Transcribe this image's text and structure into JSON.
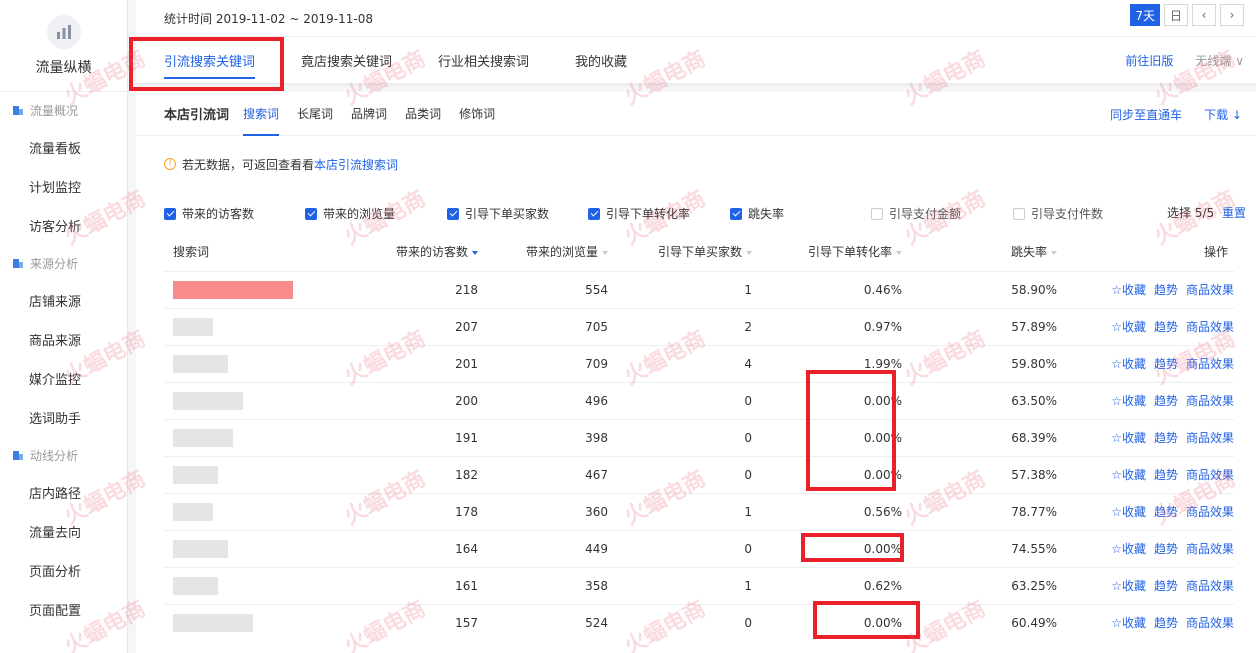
{
  "sidebar": {
    "logo_title": "流量纵横",
    "groups": [
      {
        "label": "流量概况",
        "items": [
          "流量看板",
          "计划监控",
          "访客分析"
        ]
      },
      {
        "label": "来源分析",
        "items": [
          "店铺来源",
          "商品来源",
          "媒介监控",
          "选词助手"
        ]
      },
      {
        "label": "动线分析",
        "items": [
          "店内路径",
          "流量去向",
          "页面分析",
          "页面配置"
        ]
      }
    ]
  },
  "topbar": {
    "date_range": "统计时间 2019-11-02 ~ 2019-11-08",
    "btn_7day": "7天",
    "btn_day": "日",
    "btn_prev": "‹",
    "btn_next": "›"
  },
  "main_tabs": [
    "引流搜索关键词",
    "竟店搜索关键词",
    "行业相关搜索词",
    "我的收藏"
  ],
  "tabs_right": {
    "old_version": "前往旧版",
    "device": "无线端 ∨"
  },
  "subbar": {
    "title": "本店引流词",
    "tabs": [
      "搜索词",
      "长尾词",
      "品牌词",
      "品类词",
      "修饰词"
    ],
    "sync": "同步至直通车",
    "download": "下载 ↓"
  },
  "notice": {
    "text": "若无数据，可返回查看看",
    "link": "本店引流搜索词"
  },
  "checks": [
    {
      "label": "带来的访客数",
      "on": true
    },
    {
      "label": "带来的浏览量",
      "on": true
    },
    {
      "label": "引导下单买家数",
      "on": true
    },
    {
      "label": "引导下单转化率",
      "on": true
    },
    {
      "label": "跳失率",
      "on": true
    },
    {
      "label": "引导支付金额",
      "on": false
    },
    {
      "label": "引导支付件数",
      "on": false
    }
  ],
  "checks_right": {
    "select": "选择 5/5",
    "reset": "重置"
  },
  "table": {
    "headers": [
      "搜索词",
      "带来的访客数",
      "带来的浏览量",
      "引导下单买家数",
      "引导下单转化率",
      "跳失率",
      "操作"
    ],
    "rows": [
      {
        "visitors": "218",
        "views": "554",
        "buyers": "1",
        "conv": "0.46%",
        "bounce": "58.90%"
      },
      {
        "visitors": "207",
        "views": "705",
        "buyers": "2",
        "conv": "0.97%",
        "bounce": "57.89%"
      },
      {
        "visitors": "201",
        "views": "709",
        "buyers": "4",
        "conv": "1.99%",
        "bounce": "59.80%"
      },
      {
        "visitors": "200",
        "views": "496",
        "buyers": "0",
        "conv": "0.00%",
        "bounce": "63.50%"
      },
      {
        "visitors": "191",
        "views": "398",
        "buyers": "0",
        "conv": "0.00%",
        "bounce": "68.39%"
      },
      {
        "visitors": "182",
        "views": "467",
        "buyers": "0",
        "conv": "0.00%",
        "bounce": "57.38%"
      },
      {
        "visitors": "178",
        "views": "360",
        "buyers": "1",
        "conv": "0.56%",
        "bounce": "78.77%"
      },
      {
        "visitors": "164",
        "views": "449",
        "buyers": "0",
        "conv": "0.00%",
        "bounce": "74.55%"
      },
      {
        "visitors": "161",
        "views": "358",
        "buyers": "1",
        "conv": "0.62%",
        "bounce": "63.25%"
      },
      {
        "visitors": "157",
        "views": "524",
        "buyers": "0",
        "conv": "0.00%",
        "bounce": "60.49%"
      }
    ],
    "ops": {
      "fav": "☆收藏",
      "trend": "趋势",
      "goods": "商品效果"
    }
  },
  "watermark": "火蝠电商",
  "colors": {
    "accent": "#2062e6",
    "highlight": "#e8212a"
  }
}
